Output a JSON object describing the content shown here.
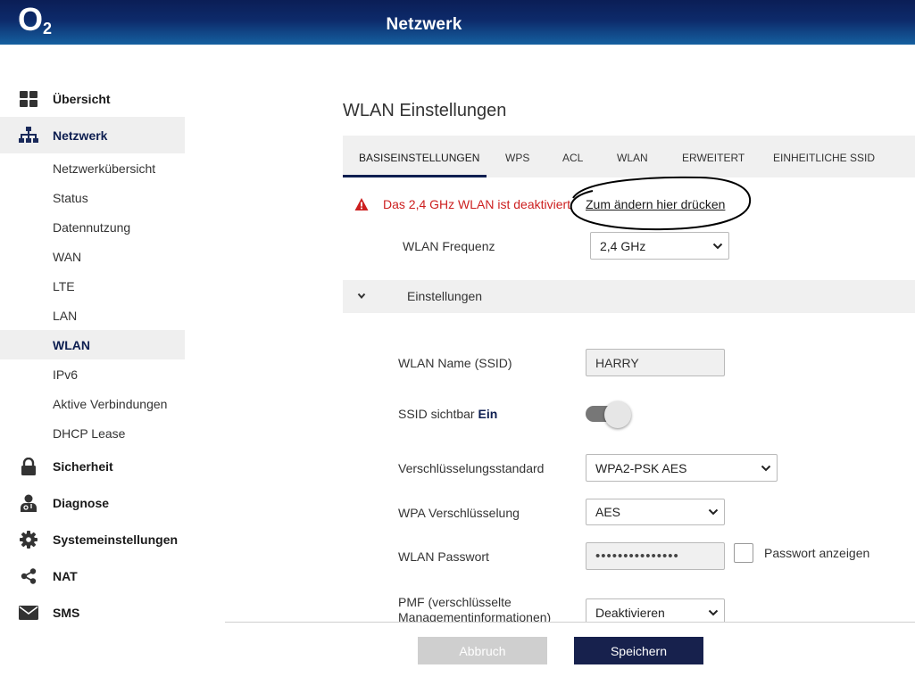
{
  "header": {
    "logo_letter": "O",
    "logo_sub": "2",
    "title": "Netzwerk"
  },
  "sidebar": {
    "main_items": [
      {
        "label": "Übersicht",
        "icon": "grid-icon"
      },
      {
        "label": "Netzwerk",
        "icon": "network-icon",
        "active": true
      },
      {
        "label": "Sicherheit",
        "icon": "lock-icon"
      },
      {
        "label": "Diagnose",
        "icon": "doctor-icon"
      },
      {
        "label": "Systemeinstellungen",
        "icon": "gear-icon"
      },
      {
        "label": "NAT",
        "icon": "share-icon"
      },
      {
        "label": "SMS",
        "icon": "envelope-icon"
      }
    ],
    "sub_items": [
      {
        "label": "Netzwerkübersicht"
      },
      {
        "label": "Status"
      },
      {
        "label": "Datennutzung"
      },
      {
        "label": "WAN"
      },
      {
        "label": "LTE"
      },
      {
        "label": "LAN"
      },
      {
        "label": "WLAN",
        "active": true
      },
      {
        "label": "IPv6"
      },
      {
        "label": "Aktive Verbindungen"
      },
      {
        "label": "DHCP Lease"
      }
    ]
  },
  "main": {
    "title": "WLAN Einstellungen",
    "tabs": [
      {
        "label": "BASISEINSTELLUNGEN",
        "active": true
      },
      {
        "label": "WPS"
      },
      {
        "label": "ACL"
      },
      {
        "label": "WLAN"
      },
      {
        "label": "ERWEITERT"
      },
      {
        "label": "EINHEITLICHE SSID"
      }
    ],
    "warning": {
      "text": "Das 2,4 GHz WLAN ist deaktiviert",
      "link": "Zum ändern hier drücken",
      "icon": "warning-icon"
    },
    "frequency": {
      "label": "WLAN Frequenz",
      "value": "2,4 GHz"
    },
    "accordion": {
      "label": "Einstellungen",
      "icon": "chevron-down-icon"
    },
    "form": {
      "ssid": {
        "label": "WLAN Name (SSID)",
        "value": "HARRY"
      },
      "visible": {
        "label": "SSID sichtbar",
        "state": "Ein",
        "on": true
      },
      "encryption_standard": {
        "label": "Verschlüsselungsstandard",
        "value": "WPA2-PSK AES"
      },
      "wpa_encryption": {
        "label": "WPA Verschlüsselung",
        "value": "AES"
      },
      "password": {
        "label": "WLAN Passwort",
        "value": "•••••••••••••••"
      },
      "show_password": {
        "label": "Passwort anzeigen",
        "checked": false
      },
      "pmf": {
        "label_line1": "PMF (verschlüsselte",
        "label_line2": "Managementinformationen)",
        "value": "Deaktivieren"
      }
    },
    "buttons": {
      "cancel": "Abbruch",
      "save": "Speichern"
    }
  },
  "colors": {
    "brand_dark": "#17214d",
    "warning_red": "#cc1f1f",
    "header_gradient_top": "#0b1e56",
    "header_gradient_bottom": "#1560a0"
  }
}
